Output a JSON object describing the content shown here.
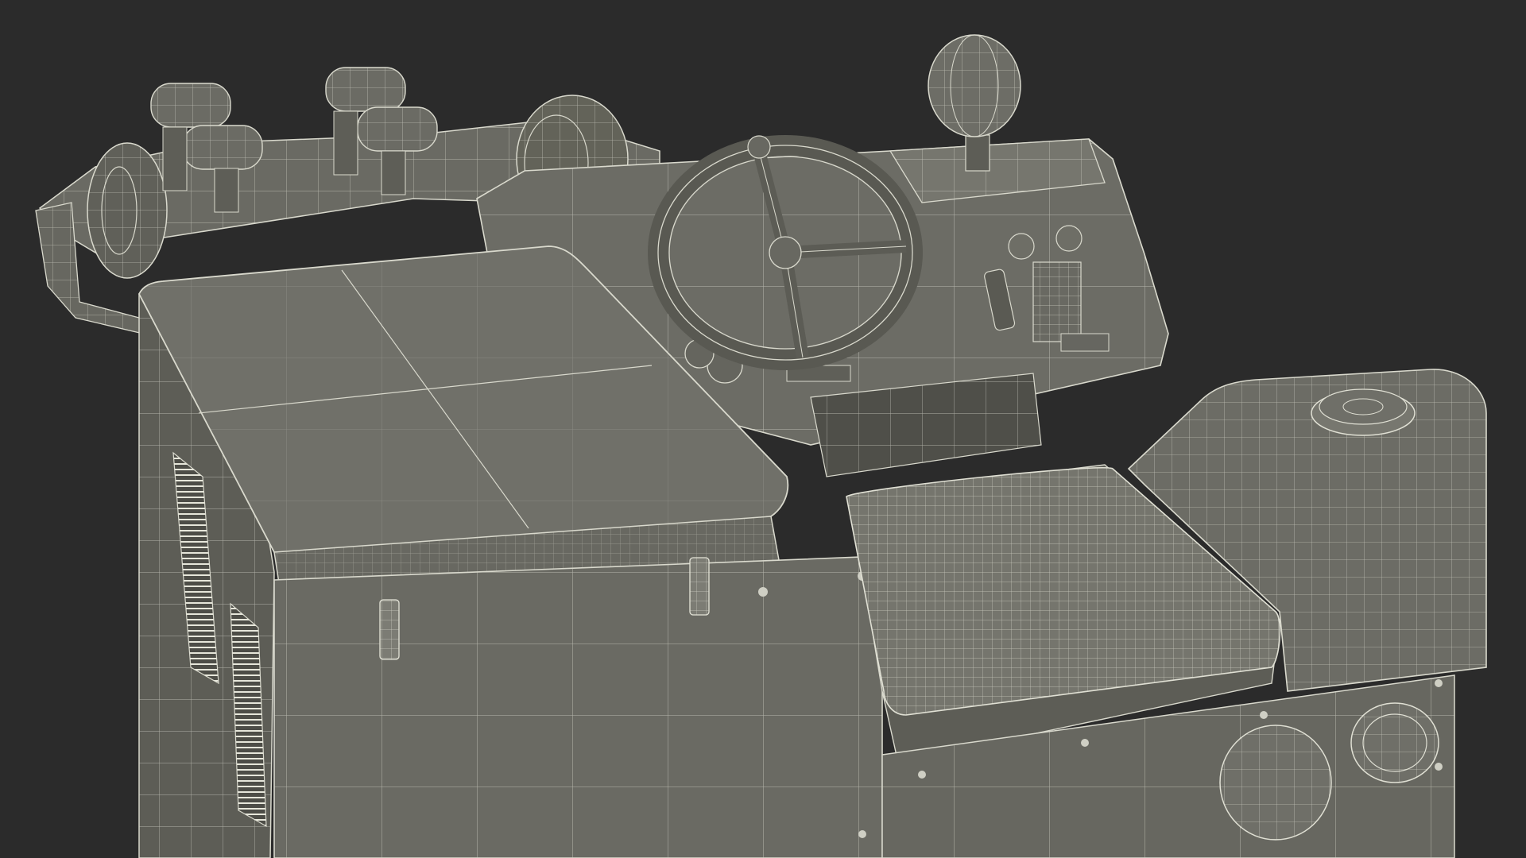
{
  "scene": {
    "subject": "wireframe-vehicle-render",
    "background_color": "#2b2b2b",
    "surface_color": "#6e6e66",
    "surface_dark_color": "#5b5b54",
    "surface_light_color": "#7d7d75",
    "wire_color": "#d9d9cd",
    "icons": [
      "steering-wheel-icon",
      "beacon-light-icon",
      "fuel-cap-icon",
      "headlight-icon"
    ]
  }
}
